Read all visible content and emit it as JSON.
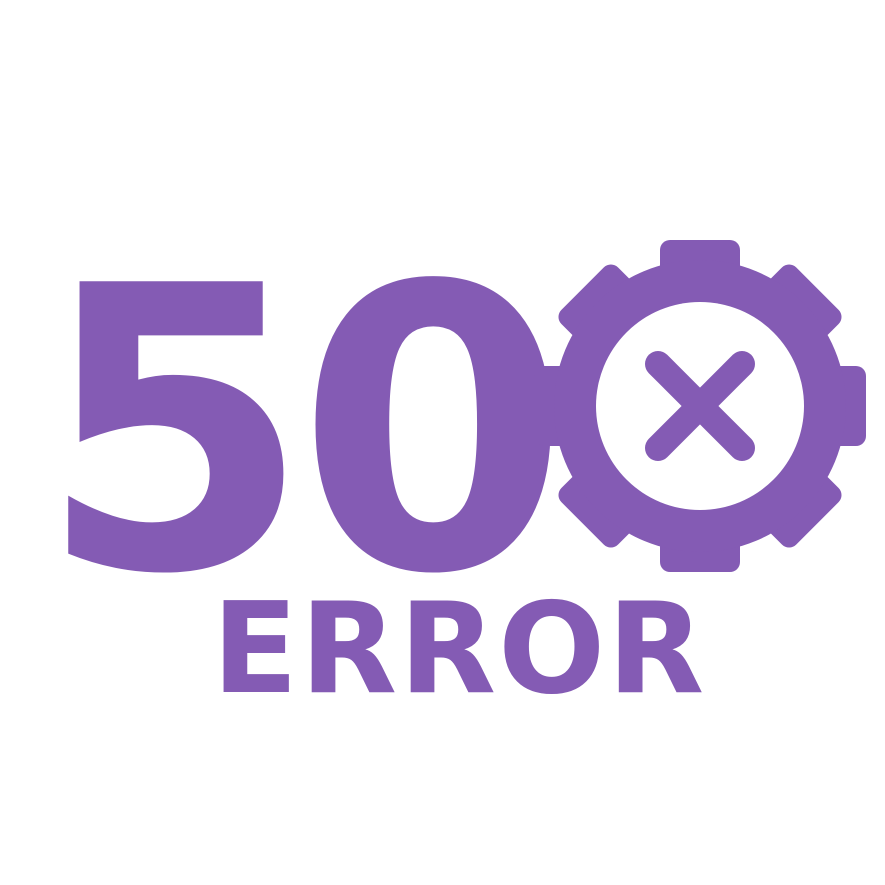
{
  "graphic": {
    "code_text": "50",
    "word_text": "ERROR",
    "icon": "gear-with-x-icon",
    "colors": {
      "accent": "#845bb4",
      "background": "#ffffff"
    }
  }
}
